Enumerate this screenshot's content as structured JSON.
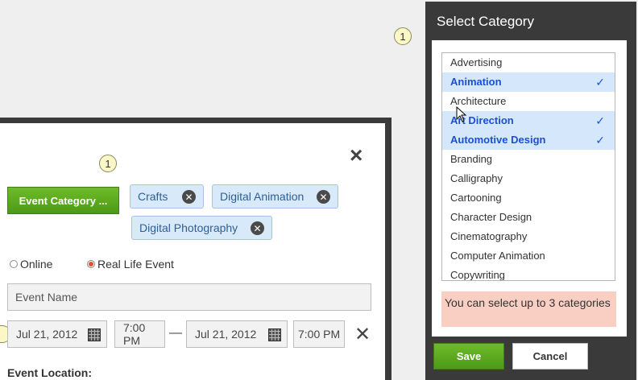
{
  "badges": {
    "top": "1",
    "dialog": "1"
  },
  "event_dialog": {
    "close_icon": "×",
    "category_button": "Event Category ...",
    "tags": [
      {
        "label": "Crafts",
        "remove_icon": "✕"
      },
      {
        "label": "Digital Animation",
        "remove_icon": "✕"
      },
      {
        "label": "Digital Photography",
        "remove_icon": "✕"
      }
    ],
    "event_type": {
      "online": "Online",
      "real_life": "Real Life Event",
      "selected": "Real Life Event"
    },
    "event_name_placeholder": "Event Name",
    "start_date": "Jul 21, 2012",
    "start_time": "7:00 PM",
    "dash": "—",
    "end_date": "Jul 21, 2012",
    "end_time": "7:00 PM",
    "row_remove_icon": "✕",
    "location_label": "Event Location:"
  },
  "category_panel": {
    "title": "Select Category",
    "items": [
      {
        "label": "Advertising",
        "selected": false
      },
      {
        "label": "Animation",
        "selected": true
      },
      {
        "label": "Architecture",
        "selected": false
      },
      {
        "label": "Art Direction",
        "selected": true
      },
      {
        "label": "Automotive Design",
        "selected": true
      },
      {
        "label": "Branding",
        "selected": false
      },
      {
        "label": "Calligraphy",
        "selected": false
      },
      {
        "label": "Cartooning",
        "selected": false
      },
      {
        "label": "Character Design",
        "selected": false
      },
      {
        "label": "Cinematography",
        "selected": false
      },
      {
        "label": "Computer Animation",
        "selected": false
      },
      {
        "label": "Copywriting",
        "selected": false
      }
    ],
    "check_icon": "✓",
    "note": "You can select up to 3 categories",
    "save_label": "Save",
    "cancel_label": "Cancel"
  },
  "colors": {
    "accent_green": "#5aa21f",
    "selection_blue": "#d4e7fb",
    "note_bg": "#f8cfc2",
    "panel_dark": "#3a3a3a"
  }
}
